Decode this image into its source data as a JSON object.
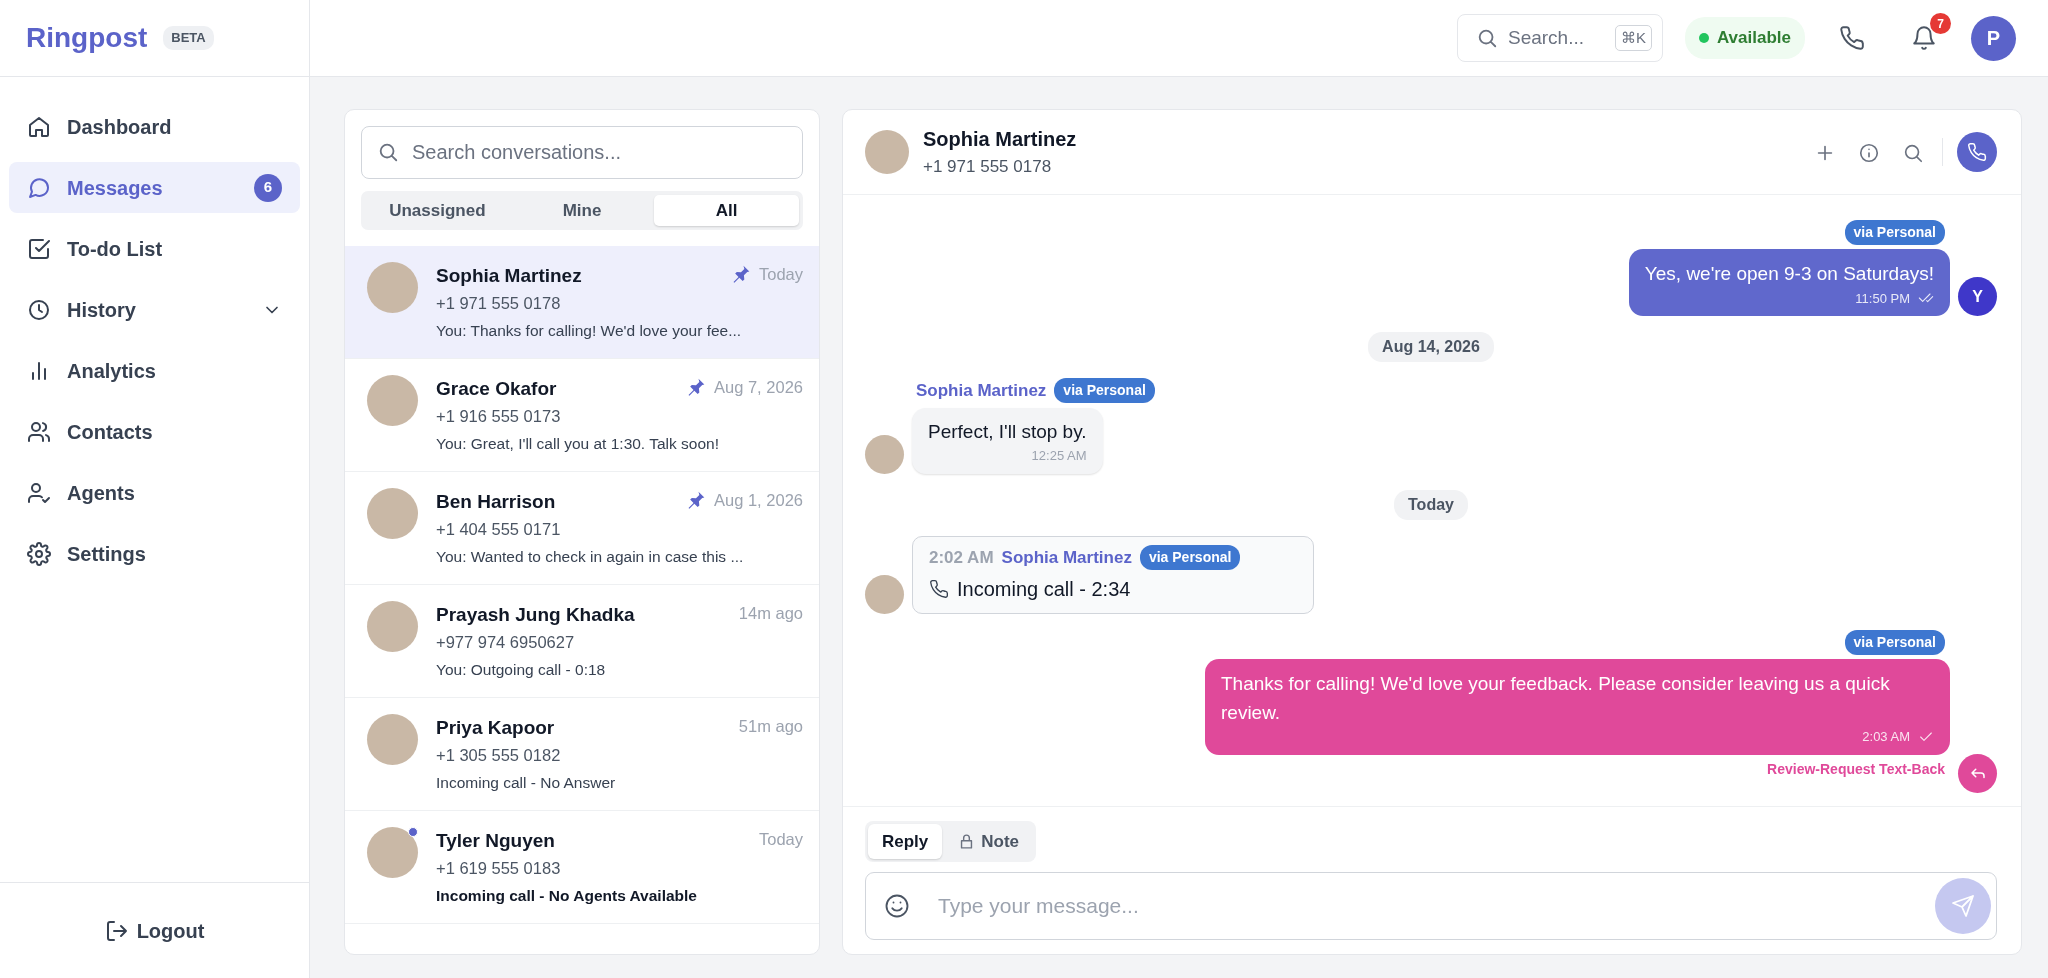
{
  "brand": {
    "name": "Ringpost",
    "badge": "BETA"
  },
  "nav": [
    {
      "label": "Dashboard",
      "selected": false
    },
    {
      "label": "Messages",
      "selected": true,
      "count": "6"
    },
    {
      "label": "To-do List",
      "selected": false
    },
    {
      "label": "History",
      "selected": false,
      "expanded": false
    },
    {
      "label": "Analytics",
      "selected": false
    },
    {
      "label": "Contacts",
      "selected": false
    },
    {
      "label": "Agents",
      "selected": false
    },
    {
      "label": "Settings",
      "selected": false
    }
  ],
  "logout": "Logout",
  "topbar": {
    "search": {
      "placeholder": "Search...",
      "shortcut": "⌘K"
    },
    "status": {
      "label": "Available",
      "color": "#22c55e"
    },
    "notifications": "7",
    "avatar": "P"
  },
  "conversations": {
    "search_placeholder": "Search conversations...",
    "filters": [
      {
        "label": "Unassigned",
        "selected": false
      },
      {
        "label": "Mine",
        "selected": false
      },
      {
        "label": "All",
        "selected": true
      }
    ],
    "items": [
      {
        "name": "Sophia Martinez",
        "phone": "+1 971 555 0178",
        "preview": "You: Thanks for calling! We'd love your fee...",
        "time": "Today",
        "pinned": true,
        "selected": true,
        "unread": false
      },
      {
        "name": "Grace Okafor",
        "phone": "+1 916 555 0173",
        "preview": "You: Great, I'll call you at 1:30. Talk soon!",
        "time": "Aug 7, 2026",
        "pinned": true,
        "selected": false,
        "unread": false
      },
      {
        "name": "Ben Harrison",
        "phone": "+1 404 555 0171",
        "preview": "You: Wanted to check in again in case this ...",
        "time": "Aug 1, 2026",
        "pinned": true,
        "selected": false,
        "unread": false
      },
      {
        "name": "Prayash Jung Khadka",
        "phone": "+977 974 6950627",
        "preview": "You: Outgoing call - 0:18",
        "time": "14m ago",
        "pinned": false,
        "selected": false,
        "unread": false
      },
      {
        "name": "Priya Kapoor",
        "phone": "+1 305 555 0182",
        "preview": "Incoming call - No Answer",
        "time": "51m ago",
        "pinned": false,
        "selected": false,
        "unread": false
      },
      {
        "name": "Tyler Nguyen",
        "phone": "+1 619 555 0183",
        "preview": "Incoming call - No Agents Available",
        "time": "Today",
        "pinned": false,
        "selected": false,
        "unread": true
      }
    ]
  },
  "chat": {
    "contact": {
      "name": "Sophia Martinez",
      "phone": "+1 971 555 0178"
    },
    "messages": [
      {
        "kind": "outgoing",
        "channel": "via Personal",
        "text": "Yes, we're open 9-3 on Saturdays!",
        "time": "11:50 PM",
        "read": true,
        "color": "#6068cc",
        "avatar": "Y"
      },
      {
        "kind": "date",
        "text": "Aug 14, 2026"
      },
      {
        "kind": "incoming",
        "sender": "Sophia Martinez",
        "channel": "via Personal",
        "text": "Perfect, I'll stop by.",
        "time": "12:25 AM"
      },
      {
        "kind": "date",
        "text": "Today"
      },
      {
        "kind": "call",
        "time": "2:02 AM",
        "sender": "Sophia Martinez",
        "channel": "via Personal",
        "text": "Incoming call - 2:34"
      },
      {
        "kind": "outgoing",
        "channel": "via Personal",
        "text": "Thanks for calling! We'd love your feedback. Please consider leaving us a quick review.",
        "time": "2:03 AM",
        "read": false,
        "color": "#e0499a",
        "automation": "Review-Request Text-Back"
      }
    ],
    "composer": {
      "tabs": [
        {
          "label": "Reply",
          "selected": true
        },
        {
          "label": "Note",
          "selected": false
        }
      ],
      "placeholder": "Type your message..."
    }
  }
}
